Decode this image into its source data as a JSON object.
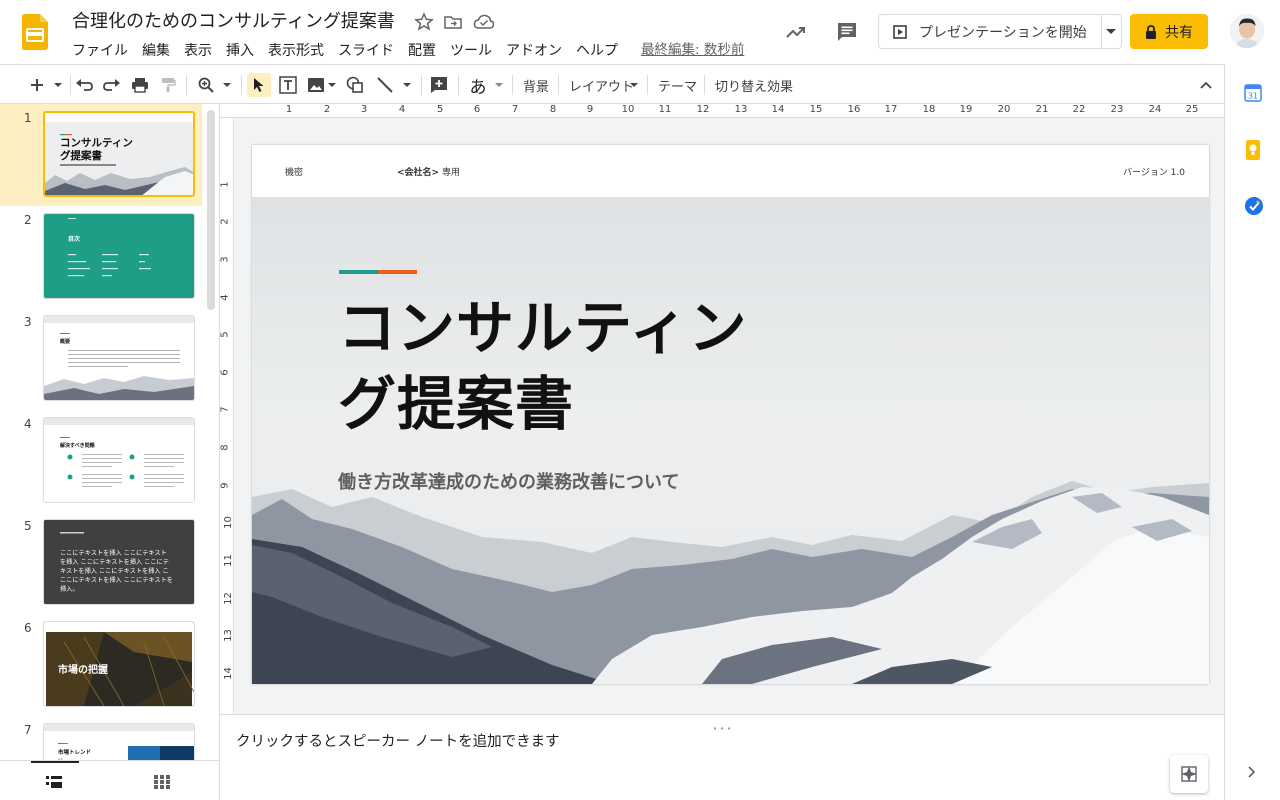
{
  "header": {
    "title": "合理化のためのコンサルティング提案書",
    "menu": [
      "ファイル",
      "編集",
      "表示",
      "挿入",
      "表示形式",
      "スライド",
      "配置",
      "ツール",
      "アドオン",
      "ヘルプ"
    ],
    "last_edit": "最終編集: 数秒前",
    "present_label": "プレゼンテーションを開始",
    "share_label": "共有"
  },
  "toolbar": {
    "background_label": "背景",
    "layout_label": "レイアウト",
    "theme_label": "テーマ",
    "transition_label": "切り替え効果",
    "text_tool_glyph": "あ"
  },
  "ruler": {
    "horizontal": [
      "1",
      "2",
      "3",
      "4",
      "5",
      "6",
      "7",
      "8",
      "9",
      "10",
      "11",
      "12",
      "13",
      "14",
      "15",
      "16",
      "17",
      "18",
      "19",
      "20",
      "21",
      "22",
      "23",
      "24",
      "25"
    ],
    "vertical": [
      "1",
      "2",
      "3",
      "4",
      "5",
      "6",
      "7",
      "8",
      "9",
      "10",
      "11",
      "12",
      "13",
      "14"
    ]
  },
  "slide": {
    "confidential": "機密",
    "company_name": "<会社名>",
    "company_suffix": "専用",
    "version": "バージョン 1.0",
    "title_line1": "コンサルティン",
    "title_line2": "グ提案書",
    "subtitle": "働き方改革達成のための業務改善について"
  },
  "filmstrip": {
    "numbers": [
      "1",
      "2",
      "3",
      "4",
      "5",
      "6",
      "7"
    ],
    "thumb1_title": "コンサルティン\nグ提案書",
    "thumb2_title": "目次",
    "thumb3_title": "概要",
    "thumb4_title": "解決すべき問題",
    "thumb5_text": "ここにテキストを挿入 ここにテキストを挿入 ここにテキストを挿入 ここにテキストを挿入 ここにテキストを挿入 ここにテキストを挿入。",
    "thumb6_title": "市場の把握",
    "thumb7_title": "市場トレンド"
  },
  "notes": {
    "placeholder": "クリックするとスピーカー ノートを追加できます"
  },
  "colors": {
    "accent_yellow": "#fbbc04",
    "teal": "#1e9e8a",
    "orange": "#e8611a",
    "selection": "#feefc3"
  }
}
